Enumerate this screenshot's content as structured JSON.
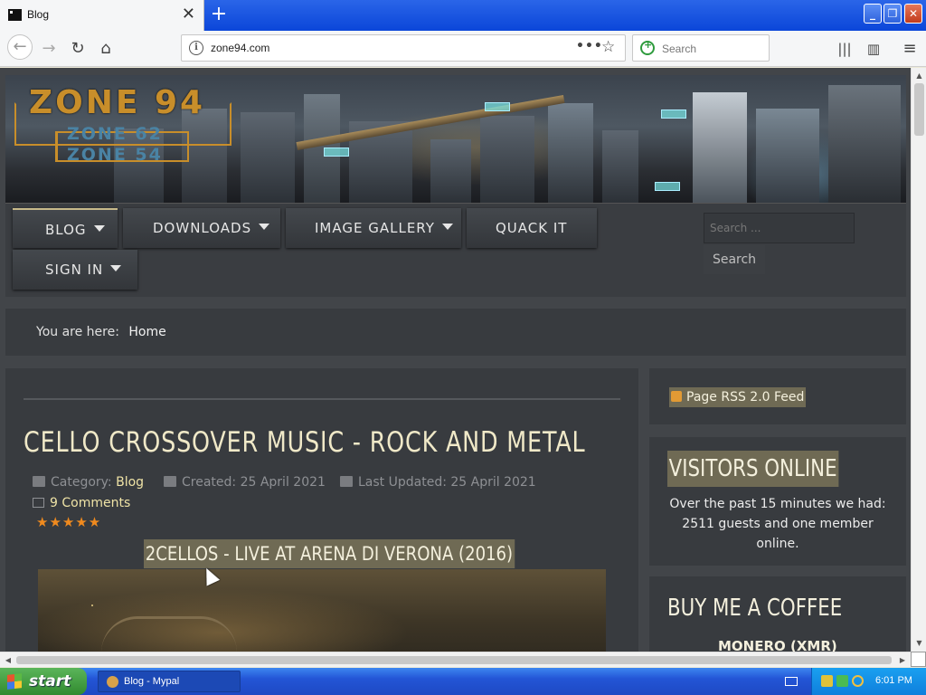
{
  "browser": {
    "tab_title": "Blog",
    "tab_close": "✕",
    "new_tab": "+",
    "url": "zone94.com",
    "page_actions": "•••",
    "search_placeholder": "Search",
    "window_controls": {
      "minimize": "_",
      "maximize": "❐",
      "close": "✕"
    }
  },
  "banner": {
    "logo": "ZONE 94",
    "logo_sub1": "ZONE 62",
    "logo_sub2": "ZONE 54"
  },
  "nav": {
    "items": [
      {
        "label": "BLOG",
        "has_dropdown": true,
        "active": true
      },
      {
        "label": "DOWNLOADS",
        "has_dropdown": true
      },
      {
        "label": "IMAGE GALLERY",
        "has_dropdown": true
      },
      {
        "label": "QUACK IT",
        "has_dropdown": false
      },
      {
        "label": "SIGN IN",
        "has_dropdown": true
      }
    ],
    "search_placeholder": "Search ...",
    "search_button": "Search"
  },
  "breadcrumb": {
    "prefix": "You are here:",
    "current": "Home"
  },
  "article": {
    "title": "CELLO CROSSOVER MUSIC - ROCK AND METAL",
    "category_label": "Category:",
    "category": "Blog",
    "created": "Created: 25 April 2021",
    "updated": "Last Updated: 25 April 2021",
    "comments": "9 Comments",
    "rating_stars": 5,
    "rating_display": "★★★★★",
    "video_title": "2CELLOS - LIVE AT ARENA DI VERONA (2016)"
  },
  "sidebar": {
    "rss": "Page RSS 2.0 Feed",
    "visitors_title": "VISITORS ONLINE",
    "visitors_text": "Over the past 15 minutes we had: 2511 guests and one member online.",
    "coffee_title": "BUY ME A COFFEE",
    "coffee_sub": "MONERO (XMR)"
  },
  "taskbar": {
    "start": "start",
    "task": "Blog - Mypal",
    "clock": "6:01 PM"
  },
  "colors": {
    "accent_text": "#efe3a6",
    "page_bg": "#424549",
    "panel_bg": "#383b3f",
    "highlight_bg": "#6f6a54",
    "star_color": "#f08a1e"
  }
}
